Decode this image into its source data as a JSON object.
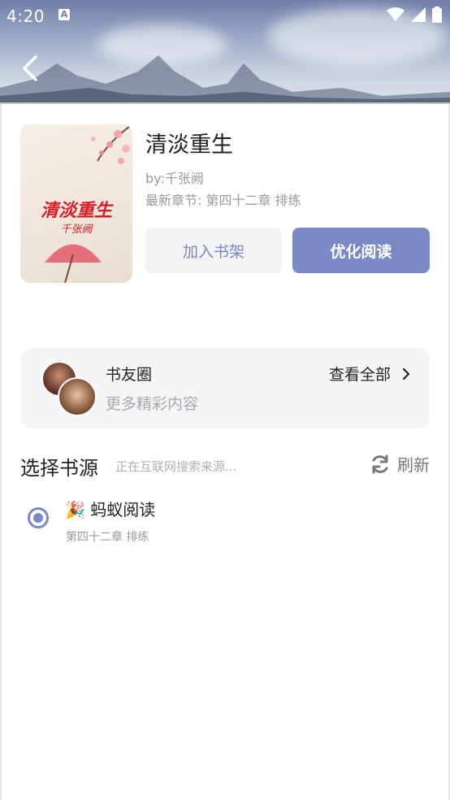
{
  "status_bar": {
    "time": "4:20",
    "notification_icon": "A"
  },
  "book": {
    "title": "清淡重生",
    "author": "by:千张阙",
    "latest_chapter": "最新章节: 第四十二章 排练",
    "cover_title": "清淡重生",
    "cover_author": "千张阙"
  },
  "actions": {
    "add_shelf": "加入书架",
    "optimize_read": "优化阅读"
  },
  "circle": {
    "title": "书友圈",
    "subtitle": "更多精彩内容",
    "view_all": "查看全部"
  },
  "sources": {
    "title": "选择书源",
    "status": "正在互联网搜索来源...",
    "refresh": "刷新",
    "items": [
      {
        "emoji": "🎉",
        "name": "蚂蚁阅读",
        "chapter": "第四十二章 排练",
        "selected": true
      }
    ]
  },
  "colors": {
    "accent": "#7a8ac5",
    "header_sky": "#9aa8c6",
    "cover_red": "#d81e2a"
  }
}
